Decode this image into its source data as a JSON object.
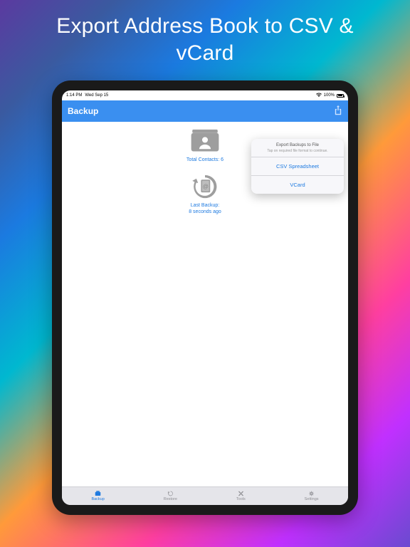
{
  "promo": {
    "title_line1": "Export Address Book to CSV &",
    "title_line2": "vCard"
  },
  "status": {
    "time": "1:14 PM",
    "date": "Wed Sep 15",
    "battery": "100%"
  },
  "header": {
    "title": "Backup"
  },
  "contacts_block": {
    "label": "Total Contacts: 6"
  },
  "backup_block": {
    "label_line1": "Last Backup:",
    "label_line2": "8 seconds ago"
  },
  "popover": {
    "title": "Export Backups to File",
    "subtitle": "Tap on required file format to continue.",
    "options": [
      "CSV Spreadsheet",
      "VCard"
    ]
  },
  "tabs": [
    {
      "label": "Backup"
    },
    {
      "label": "Restore"
    },
    {
      "label": "Tools"
    },
    {
      "label": "Settings"
    }
  ],
  "colors": {
    "accent": "#1e7ae0",
    "header_bg": "#3a8ff0"
  }
}
